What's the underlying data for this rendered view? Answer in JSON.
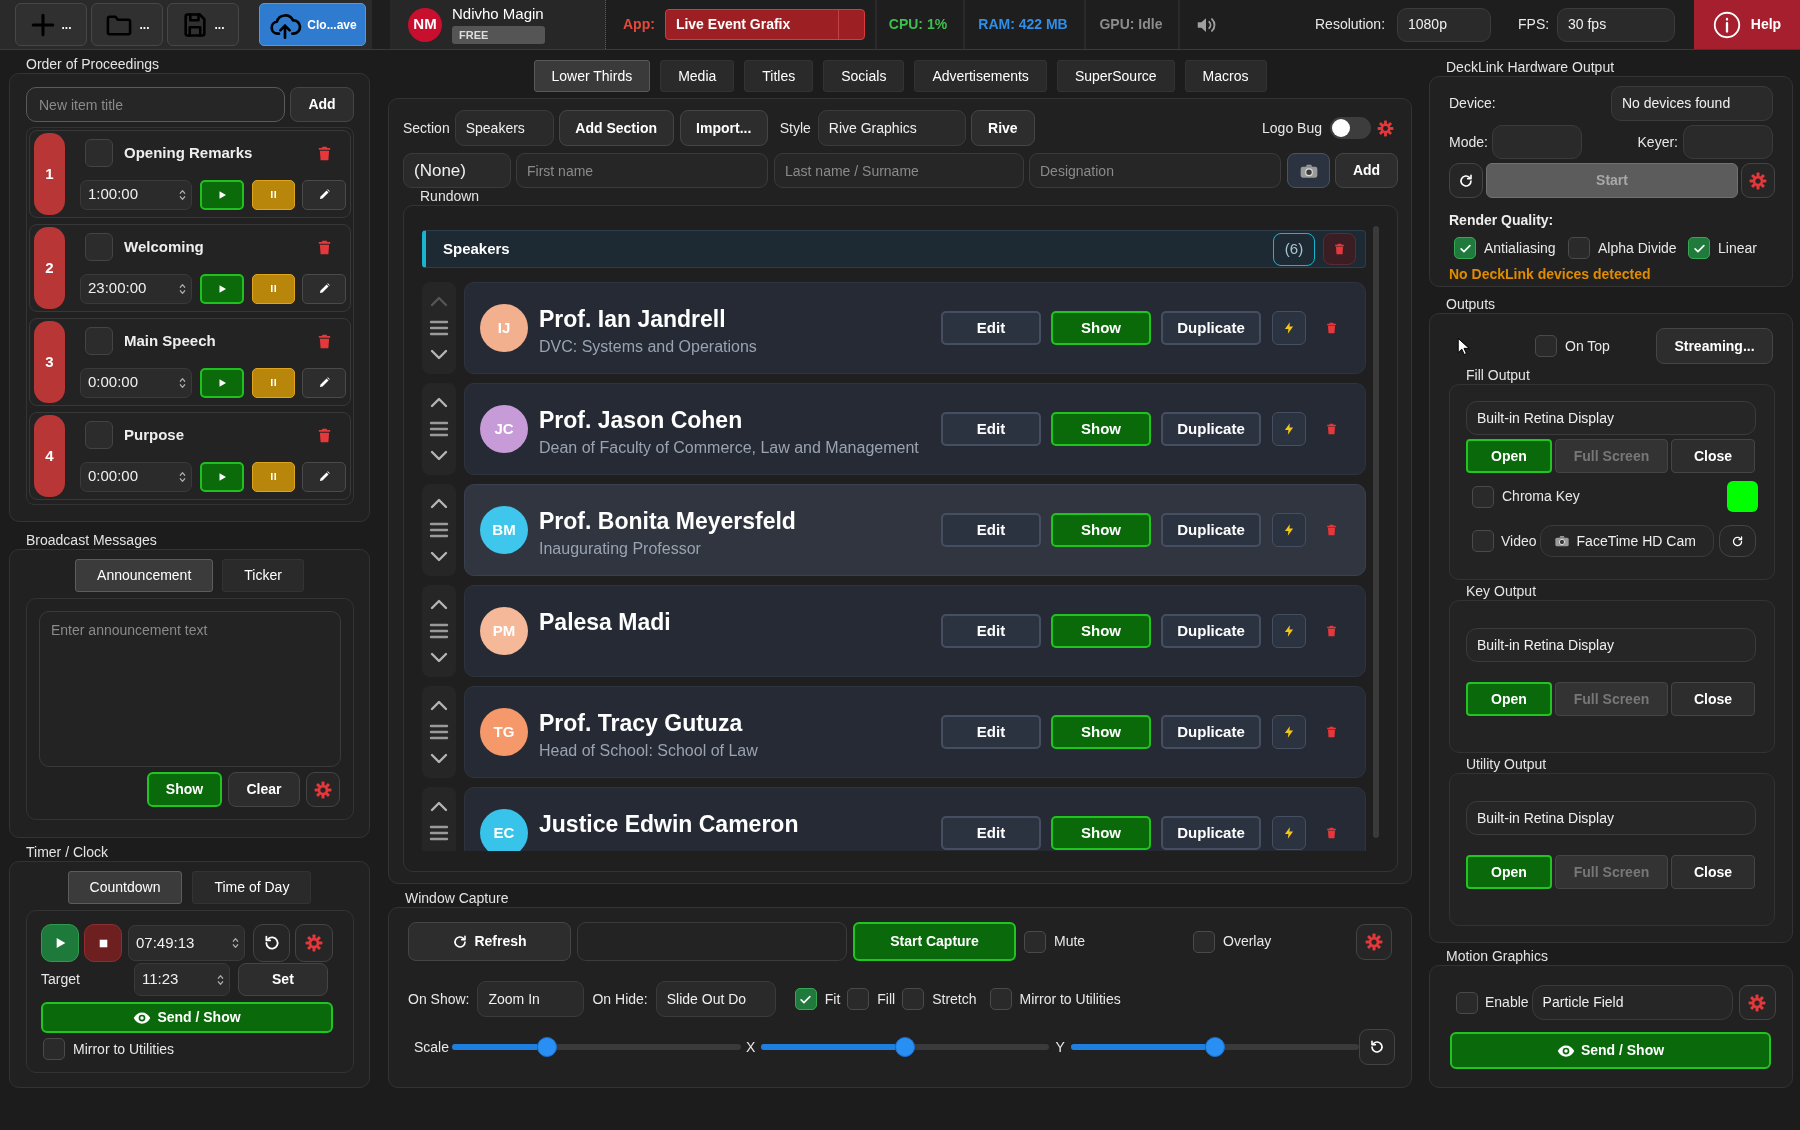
{
  "toolbar": {
    "buttons": [
      {
        "kind": "new",
        "label": "..."
      },
      {
        "kind": "open",
        "label": "..."
      },
      {
        "kind": "save",
        "label": "..."
      },
      {
        "kind": "cloud",
        "label": "Clo...ave"
      }
    ],
    "user": {
      "initials": "NM",
      "name": "Ndivho Magin",
      "plan": "FREE"
    },
    "app": {
      "label": "App:",
      "value": "Live Event Grafix"
    },
    "stats": [
      {
        "text": "CPU: 1%",
        "color": "#3fbf4f"
      },
      {
        "text": "RAM: 422 MB",
        "color": "#2f8fe8"
      },
      {
        "text": "GPU: Idle",
        "color": "#8c8c8c"
      }
    ],
    "resolution": {
      "label": "Resolution:",
      "value": "1080p"
    },
    "fps": {
      "label": "FPS:",
      "value": "30 fps"
    },
    "help": "Help"
  },
  "proceedings": {
    "title": "Order of Proceedings",
    "new_item_placeholder": "New item title",
    "add_button": "Add",
    "items": [
      {
        "number": "1",
        "title": "Opening Remarks",
        "checked": false,
        "time": "1:00:00"
      },
      {
        "number": "2",
        "title": "Welcoming",
        "checked": false,
        "time": "23:00:00"
      },
      {
        "number": "3",
        "title": "Main Speech",
        "checked": false,
        "time": "0:00:00"
      },
      {
        "number": "4",
        "title": "Purpose",
        "checked": false,
        "time": "0:00:00"
      }
    ]
  },
  "broadcast": {
    "title": "Broadcast Messages",
    "tabs": [
      {
        "label": "Announcement",
        "selected": true
      },
      {
        "label": "Ticker",
        "selected": false
      }
    ],
    "placeholder": "Enter announcement text",
    "show_button": "Show",
    "clear_button": "Clear"
  },
  "timer": {
    "title": "Timer / Clock",
    "tabs": [
      {
        "label": "Countdown",
        "selected": true
      },
      {
        "label": "Time of Day",
        "selected": false
      }
    ],
    "time": "07:49:13",
    "target_label": "Target",
    "target": "11:23",
    "set_button": "Set",
    "send_button": "Send / Show",
    "mirror": {
      "label": "Mirror to Utilities",
      "checked": false
    }
  },
  "main_tabs": [
    {
      "label": "Lower Thirds",
      "selected": true
    },
    {
      "label": "Media",
      "selected": false
    },
    {
      "label": "Titles",
      "selected": false
    },
    {
      "label": "Socials",
      "selected": false
    },
    {
      "label": "Advertisements",
      "selected": false
    },
    {
      "label": "SuperSource",
      "selected": false
    },
    {
      "label": "Macros",
      "selected": false
    }
  ],
  "lower_thirds": {
    "section_label": "Section",
    "section": "Speakers",
    "add_section_button": "Add Section",
    "import_button": "Import...",
    "style_label": "Style",
    "style": "Rive Graphics",
    "rive_button": "Rive",
    "logo_bug": {
      "label": "Logo Bug",
      "on": false
    },
    "prefix": "(None)",
    "first_name_placeholder": "First name",
    "last_name_placeholder": "Last name / Surname",
    "designation_placeholder": "Designation",
    "add_button": "Add",
    "rundown": {
      "title": "Rundown",
      "section": {
        "name": "Speakers",
        "count": "(6)"
      },
      "entries": [
        {
          "initials": "IJ",
          "color": "#f3b08e",
          "name": "Prof. Ian Jandrell",
          "designation": "DVC: Systems and Operations",
          "selected": false,
          "up_disabled": true,
          "actions": [
            {
              "kind": "edit",
              "label": "Edit"
            },
            {
              "kind": "show",
              "label": "Show"
            },
            {
              "kind": "duplicate",
              "label": "Duplicate"
            }
          ]
        },
        {
          "initials": "JC",
          "color": "#c79ad8",
          "name": "Prof. Jason Cohen",
          "designation": "Dean of Faculty of Commerce, Law and Management",
          "selected": false,
          "up_disabled": false,
          "actions": [
            {
              "kind": "edit",
              "label": "Edit"
            },
            {
              "kind": "show",
              "label": "Show"
            },
            {
              "kind": "duplicate",
              "label": "Duplicate"
            }
          ]
        },
        {
          "initials": "BM",
          "color": "#3fc6ec",
          "name": "Prof. Bonita Meyersfeld",
          "designation": "Inaugurating Professor",
          "selected": true,
          "up_disabled": false,
          "actions": [
            {
              "kind": "edit",
              "label": "Edit"
            },
            {
              "kind": "show",
              "label": "Show"
            },
            {
              "kind": "duplicate",
              "label": "Duplicate"
            }
          ]
        },
        {
          "initials": "PM",
          "color": "#f5b898",
          "name": "Palesa Madi",
          "selected": false,
          "up_disabled": false,
          "actions": [
            {
              "kind": "edit",
              "label": "Edit"
            },
            {
              "kind": "show",
              "label": "Show"
            },
            {
              "kind": "duplicate",
              "label": "Duplicate"
            }
          ]
        },
        {
          "initials": "TG",
          "color": "#f5996b",
          "name": "Prof. Tracy Gutuza",
          "designation": "Head of School: School of Law",
          "selected": false,
          "up_disabled": false,
          "actions": [
            {
              "kind": "edit",
              "label": "Edit"
            },
            {
              "kind": "show",
              "label": "Show"
            },
            {
              "kind": "duplicate",
              "label": "Duplicate"
            }
          ]
        },
        {
          "initials": "EC",
          "color": "#38c4ea",
          "name": "Justice Edwin Cameron",
          "selected": false,
          "up_disabled": false,
          "actions": [
            {
              "kind": "edit",
              "label": "Edit"
            },
            {
              "kind": "show",
              "label": "Show"
            },
            {
              "kind": "duplicate",
              "label": "Duplicate"
            }
          ]
        }
      ]
    }
  },
  "window_capture": {
    "title": "Window Capture",
    "refresh_button": "Refresh",
    "start_button": "Start Capture",
    "toggles": [
      {
        "label": "Mute",
        "checked": false
      },
      {
        "label": "Overlay",
        "checked": false
      }
    ],
    "on_show_label": "On Show:",
    "on_show": "Zoom In",
    "on_hide_label": "On Hide:",
    "on_hide": "Slide Out Do",
    "fit_options": [
      {
        "label": "Fit",
        "checked": true
      },
      {
        "label": "Fill",
        "checked": false
      },
      {
        "label": "Stretch",
        "checked": false
      },
      {
        "label": "Mirror to Utilities",
        "checked": false
      }
    ],
    "sliders": [
      {
        "label": "Scale",
        "level": 0.33
      },
      {
        "label": "X",
        "level": 0.5
      },
      {
        "label": "Y",
        "level": 0.5
      }
    ]
  },
  "decklink": {
    "title": "DeckLink Hardware Output",
    "device_label": "Device:",
    "device": "No devices found",
    "mode_label": "Mode:",
    "keyer_label": "Keyer:",
    "start": {
      "label": "Start",
      "disabled": true
    },
    "render_quality_label": "Render Quality:",
    "render_options": [
      {
        "label": "Antialiasing",
        "checked": true
      },
      {
        "label": "Alpha Divide",
        "checked": false
      },
      {
        "label": "Linear",
        "checked": true
      }
    ],
    "warning": "No DeckLink devices detected"
  },
  "outputs": {
    "title": "Outputs",
    "on_top": {
      "label": "On Top",
      "checked": false
    },
    "streaming_button": "Streaming...",
    "groups": [
      {
        "title": "Fill Output",
        "display": "Built-in Retina Display",
        "buttons": [
          {
            "kind": "open",
            "label": "Open",
            "disabled": false
          },
          {
            "kind": "full_screen",
            "label": "Full Screen",
            "disabled": true
          },
          {
            "kind": "close",
            "label": "Close",
            "disabled": false
          }
        ],
        "chroma_key": {
          "label": "Chroma Key",
          "checked": false,
          "color": "#00ff00"
        },
        "video": {
          "label": "Video",
          "checked": false,
          "source": "FaceTime HD Cam"
        }
      },
      {
        "title": "Key Output",
        "display": "Built-in Retina Display",
        "buttons": [
          {
            "kind": "open",
            "label": "Open",
            "disabled": false
          },
          {
            "kind": "full_screen",
            "label": "Full Screen",
            "disabled": true
          },
          {
            "kind": "close",
            "label": "Close",
            "disabled": false
          }
        ]
      },
      {
        "title": "Utility Output",
        "display": "Built-in Retina Display",
        "buttons": [
          {
            "kind": "open",
            "label": "Open",
            "disabled": false
          },
          {
            "kind": "full_screen",
            "label": "Full Screen",
            "disabled": true
          },
          {
            "kind": "close",
            "label": "Close",
            "disabled": false
          }
        ]
      }
    ]
  },
  "motion_graphics": {
    "title": "Motion Graphics",
    "enable": {
      "label": "Enable",
      "checked": false
    },
    "preset": "Particle Field",
    "send_button": "Send / Show"
  }
}
